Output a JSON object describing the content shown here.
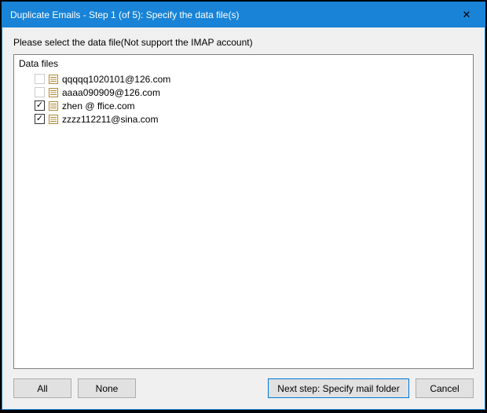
{
  "window": {
    "title": "Duplicate Emails - Step 1 (of 5): Specify the data file(s)"
  },
  "instruction": "Please select the data file(Not support the IMAP account)",
  "list": {
    "header": "Data files",
    "items": [
      {
        "label": "qqqqq1020101@126.com",
        "checked": false
      },
      {
        "label": "aaaa090909@126.com",
        "checked": false
      },
      {
        "label": "zhen        @            ffice.com",
        "checked": true
      },
      {
        "label": "zzzz112211@sina.com",
        "checked": true
      }
    ]
  },
  "buttons": {
    "all": "All",
    "none": "None",
    "next": "Next step: Specify mail folder",
    "cancel": "Cancel"
  },
  "glyphs": {
    "check": "✓",
    "close": "✕"
  }
}
